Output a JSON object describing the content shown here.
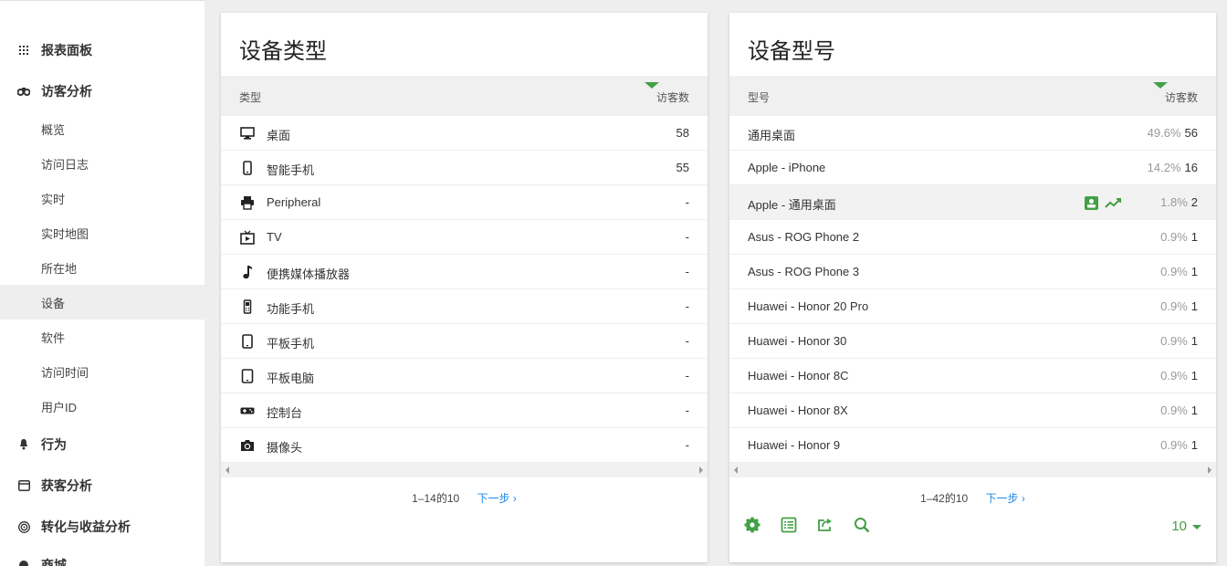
{
  "sidebar": {
    "sections": [
      {
        "label": "报表面板",
        "icon": "dashboard-grid-icon"
      },
      {
        "label": "访客分析",
        "icon": "binoculars-icon"
      },
      {
        "label": "行为",
        "icon": "bell-icon"
      },
      {
        "label": "获客分析",
        "icon": "acquisition-icon"
      },
      {
        "label": "转化与收益分析",
        "icon": "target-icon"
      },
      {
        "label": "商城",
        "icon": "shop-icon"
      }
    ],
    "visitor_items": [
      "概览",
      "访问日志",
      "实时",
      "实时地图",
      "所在地",
      "设备",
      "软件",
      "访问时间",
      "用户ID"
    ],
    "active_item": "设备"
  },
  "device_type": {
    "title": "设备类型",
    "col_label": "类型",
    "col_value": "访客数",
    "rows": [
      {
        "label": "桌面",
        "value": "58",
        "icon": "desktop-icon"
      },
      {
        "label": "智能手机",
        "value": "55",
        "icon": "smartphone-icon"
      },
      {
        "label": "Peripheral",
        "value": "-",
        "icon": "printer-icon"
      },
      {
        "label": "TV",
        "value": "-",
        "icon": "tv-icon"
      },
      {
        "label": "便携媒体播放器",
        "value": "-",
        "icon": "music-note-icon"
      },
      {
        "label": "功能手机",
        "value": "-",
        "icon": "feature-phone-icon"
      },
      {
        "label": "平板手机",
        "value": "-",
        "icon": "phablet-icon"
      },
      {
        "label": "平板电脑",
        "value": "-",
        "icon": "tablet-icon"
      },
      {
        "label": "控制台",
        "value": "-",
        "icon": "gamepad-icon"
      },
      {
        "label": "摄像头",
        "value": "-",
        "icon": "camera-icon"
      }
    ],
    "pager_range": "1–14的10",
    "pager_next": "下一步 ›"
  },
  "device_model": {
    "title": "设备型号",
    "col_label": "型号",
    "col_value": "访客数",
    "rows": [
      {
        "label": "通用桌面",
        "pct": "49.6%",
        "value": "56"
      },
      {
        "label": "Apple - iPhone",
        "pct": "14.2%",
        "value": "16"
      },
      {
        "label": "Apple - 通用桌面",
        "pct": "1.8%",
        "value": "2"
      },
      {
        "label": "Asus - ROG Phone 2",
        "pct": "0.9%",
        "value": "1"
      },
      {
        "label": "Asus - ROG Phone 3",
        "pct": "0.9%",
        "value": "1"
      },
      {
        "label": "Huawei - Honor 20 Pro",
        "pct": "0.9%",
        "value": "1"
      },
      {
        "label": "Huawei - Honor 30",
        "pct": "0.9%",
        "value": "1"
      },
      {
        "label": "Huawei - Honor 8C",
        "pct": "0.9%",
        "value": "1"
      },
      {
        "label": "Huawei - Honor 8X",
        "pct": "0.9%",
        "value": "1"
      },
      {
        "label": "Huawei - Honor 9",
        "pct": "0.9%",
        "value": "1"
      }
    ],
    "highlighted_row": 2,
    "pager_range": "1–42的10",
    "pager_next": "下一步 ›",
    "limit": "10",
    "footer_icons": [
      "gear-icon",
      "table-icon",
      "export-icon",
      "search-icon"
    ]
  },
  "colors": {
    "accent": "#43a047",
    "link": "#1e88e5",
    "muted": "#999999"
  }
}
